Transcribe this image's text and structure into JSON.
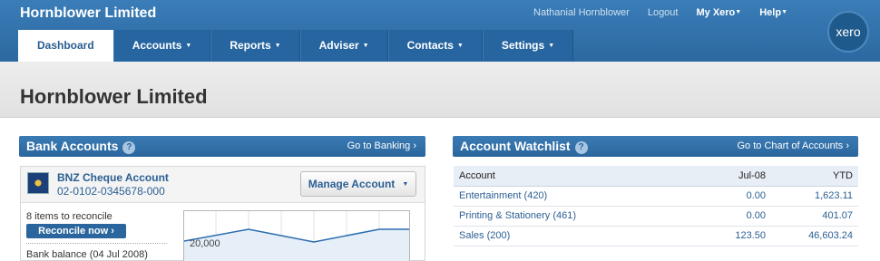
{
  "header": {
    "org_name": "Hornblower Limited",
    "user": "Nathanial Hornblower",
    "logout": "Logout",
    "my_xero": "My Xero",
    "help": "Help",
    "logo_text": "xero"
  },
  "tabs": [
    {
      "label": "Dashboard",
      "active": true
    },
    {
      "label": "Accounts"
    },
    {
      "label": "Reports"
    },
    {
      "label": "Adviser"
    },
    {
      "label": "Contacts"
    },
    {
      "label": "Settings"
    }
  ],
  "page": {
    "title": "Hornblower Limited"
  },
  "bank_accounts": {
    "title": "Bank Accounts",
    "link": "Go to Banking ›",
    "account_name": "BNZ Cheque Account",
    "account_number": "02-0102-0345678-000",
    "manage_button": "Manage Account",
    "reconcile_text": "8 items to reconcile",
    "reconcile_button": "Reconcile now ›",
    "balance_label": "Bank balance (04 Jul 2008)",
    "chart_tick": "20,000"
  },
  "watchlist": {
    "title": "Account Watchlist",
    "link": "Go to Chart of Accounts ›",
    "columns": [
      "Account",
      "Jul-08",
      "YTD"
    ],
    "rows": [
      {
        "account": "Entertainment (420)",
        "month": "0.00",
        "ytd": "1,623.11"
      },
      {
        "account": "Printing & Stationery (461)",
        "month": "0.00",
        "ytd": "401.07"
      },
      {
        "account": "Sales (200)",
        "month": "123.50",
        "ytd": "46,603.24"
      }
    ]
  },
  "colors": {
    "brand": "#2c68a0",
    "link": "#2b5f93"
  }
}
